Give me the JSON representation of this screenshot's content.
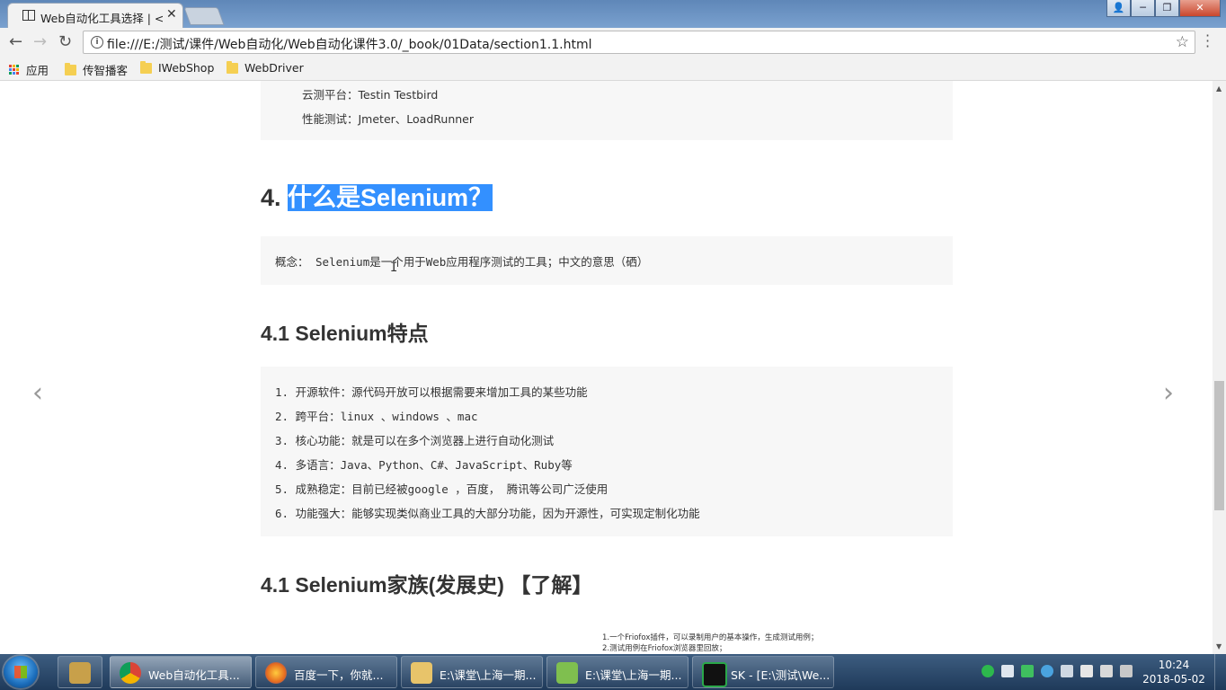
{
  "browser": {
    "tab_title": "Web自动化工具选择 | <",
    "tab_close": "✕",
    "url": "file:///E:/测试/课件/Web自动化/Web自动化课件3.0/_book/01Data/section1.1.html",
    "window_buttons": {
      "user": "👤",
      "minimize": "─",
      "maximize": "❐",
      "close": "✕"
    }
  },
  "bookmarks": [
    {
      "label": "应用",
      "icon": "apps-icon"
    },
    {
      "label": "传智播客",
      "icon": "folder-icon"
    },
    {
      "label": "IWebShop",
      "icon": "folder-icon"
    },
    {
      "label": "WebDriver",
      "icon": "folder-icon"
    }
  ],
  "content": {
    "top_box": {
      "line1": "云测平台：Testin Testbird",
      "line2": "性能测试：Jmeter、LoadRunner"
    },
    "heading4_num": "4. ",
    "heading4_text": "什么是Selenium？",
    "concept": "概念： Selenium是一个用于Web应用程序测试的工具；中文的意思（硒）",
    "heading41": "4.1 Selenium特点",
    "features": [
      "1. 开源软件：源代码开放可以根据需要来增加工具的某些功能",
      "2. 跨平台：linux 、windows 、mac",
      "3. 核心功能：就是可以在多个浏览器上进行自动化测试",
      "4. 多语言：Java、Python、C#、JavaScript、Ruby等",
      "5. 成熟稳定：目前已经被google ，百度， 腾讯等公司广泛使用",
      "6. 功能强大：能够实现类似商业工具的大部分功能，因为开源性，可实现定制化功能"
    ],
    "heading41b": "4.1 Selenium家族(发展史) 【了解】",
    "image_text": [
      "1.一个Friofox插件，可以录制用户的基本操作，生成测试用例；",
      "2.测试用例在Friofox浏览器里回放；"
    ],
    "prev_arrow": "‹",
    "next_arrow": "›"
  },
  "taskbar": {
    "tasks": [
      {
        "label": "",
        "icon_color": "#c8a04a"
      },
      {
        "label": "Web自动化工具...",
        "icon_color": "#e8e8e8"
      },
      {
        "label": "百度一下，你就...",
        "icon_color": "#e66b1f"
      },
      {
        "label": "E:\\课堂\\上海一期...",
        "icon_color": "#e8c46a"
      },
      {
        "label": "E:\\课堂\\上海一期...",
        "icon_color": "#7fbf4f"
      },
      {
        "label": "SK - [E:\\测试\\We...",
        "icon_color": "#2aa84a"
      }
    ],
    "time": "10:24",
    "date": "2018-05-02"
  }
}
